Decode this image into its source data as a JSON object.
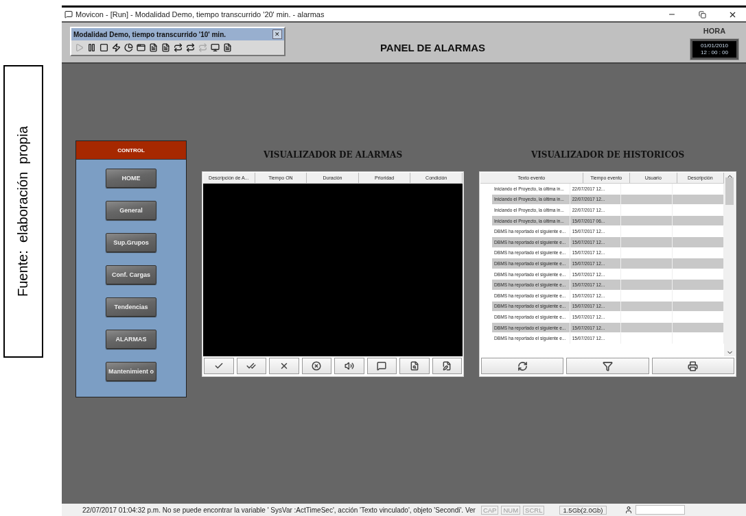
{
  "caption": "Fuente:  elaboración  propia",
  "window": {
    "title": "Movicon - [Run] - Modalidad Demo, tiempo transcurrido '20' min. - alarmas"
  },
  "demo_box": {
    "title": "Modalidad Demo, tiempo transcurrido '10' min.",
    "close": "✕",
    "tools": [
      {
        "kind": "play",
        "disabled": true
      },
      {
        "kind": "pause",
        "disabled": false
      },
      {
        "kind": "stop",
        "disabled": false
      },
      {
        "kind": "bolt",
        "disabled": false
      },
      {
        "kind": "pie",
        "disabled": false
      },
      {
        "kind": "window",
        "disabled": false
      },
      {
        "kind": "doc",
        "disabled": false
      },
      {
        "kind": "doc",
        "disabled": false
      },
      {
        "kind": "swap",
        "disabled": false
      },
      {
        "kind": "swap",
        "disabled": false
      },
      {
        "kind": "swap",
        "disabled": true
      },
      {
        "kind": "monitor",
        "disabled": false
      },
      {
        "kind": "doc",
        "disabled": false
      }
    ]
  },
  "header": {
    "title": "PANEL DE ALARMAS",
    "clock_label": "HORA",
    "date": "01/01/2010",
    "time": "12 : 00 : 00"
  },
  "control": {
    "title": "CONTROL",
    "buttons": [
      "HOME",
      "General",
      "Sup.Grupos",
      "Conf. Cargas",
      "Tendencias",
      "ALARMAS",
      "Mantenimient o"
    ]
  },
  "alarms": {
    "title": "VISUALIZADOR DE ALARMAS",
    "columns": [
      "Descripción de A...",
      "Tiempo ON",
      "Duración",
      "Prioridad",
      "Condición"
    ],
    "buttons": [
      {
        "kind": "check"
      },
      {
        "kind": "double-check"
      },
      {
        "kind": "cross"
      },
      {
        "kind": "cancel"
      },
      {
        "kind": "sound"
      },
      {
        "kind": "info"
      },
      {
        "kind": "search"
      },
      {
        "kind": "edit"
      }
    ]
  },
  "history": {
    "title": "VISUALIZADOR DE HISTORICOS",
    "columns": [
      "Texto evento",
      "Tiempo evento",
      "Usuario",
      "Descripción"
    ],
    "rows": [
      [
        "Iniciando el Proyecto, la última in...",
        "22/07/2017 12..."
      ],
      [
        "Iniciando el Proyecto, la última in...",
        "22/07/2017 12..."
      ],
      [
        "Iniciando el Proyecto, la última in...",
        "22/07/2017 12..."
      ],
      [
        "Iniciando el Proyecto, la última in...",
        "15/07/2017 06..."
      ],
      [
        "DBMS ha reportado el siguiente e...",
        "15/07/2017 12..."
      ],
      [
        "DBMS ha reportado el siguiente e...",
        "15/07/2017 12..."
      ],
      [
        "DBMS ha reportado el siguiente e...",
        "15/07/2017 12..."
      ],
      [
        "DBMS ha reportado el siguiente e...",
        "15/07/2017 12..."
      ],
      [
        "DBMS ha reportado el siguiente e...",
        "15/07/2017 12..."
      ],
      [
        "DBMS ha reportado el siguiente e...",
        "15/07/2017 12..."
      ],
      [
        "DBMS ha reportado el siguiente e...",
        "15/07/2017 12..."
      ],
      [
        "DBMS ha reportado el siguiente e...",
        "15/07/2017 12..."
      ],
      [
        "DBMS ha reportado el siguiente e...",
        "15/07/2017 12..."
      ],
      [
        "DBMS ha reportado el siguiente e...",
        "15/07/2017 12..."
      ],
      [
        "DBMS ha reportado el siguiente e...",
        "15/07/2017 12..."
      ]
    ],
    "buttons": [
      {
        "kind": "refresh"
      },
      {
        "kind": "filter"
      },
      {
        "kind": "print"
      }
    ]
  },
  "status_bar": {
    "message": "22/07/2017 01:04:32 p.m. No se puede encontrar la variable ' SysVar :ActTimeSec', acción 'Texto vinculado', objeto 'Secondi'. Ver",
    "indicators": [
      "CAP",
      "NUM",
      "SCRL"
    ],
    "memory": "1.5Gb(2.0Gb)"
  }
}
